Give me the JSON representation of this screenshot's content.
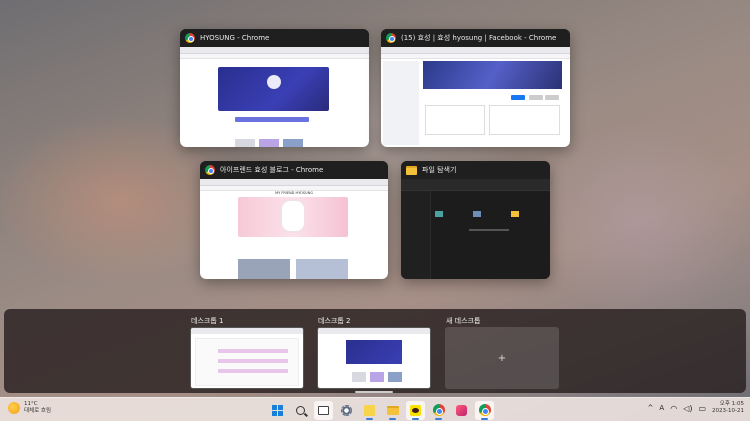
{
  "windows": [
    {
      "title": "HYOSUNG - Chrome",
      "icon": "chrome-icon"
    },
    {
      "title": "(15) 효성 | 효성 hyosung | Facebook - Chrome",
      "icon": "chrome-icon"
    },
    {
      "title": "아이프렌드 효성 블로그 - Chrome",
      "icon": "chrome-icon"
    },
    {
      "title": "파일 탐색기",
      "icon": "folder-icon"
    }
  ],
  "blog_banner_text": "MY FRIEND HYOSUNG",
  "desktops": [
    {
      "label": "데스크톱 1"
    },
    {
      "label": "데스크톱 2"
    },
    {
      "label": "새 데스크톱",
      "plus": "+"
    }
  ],
  "weather": {
    "temp": "11°C",
    "desc": "대체로 흐림"
  },
  "tray": {
    "caret": "^",
    "ime": "A",
    "clock_time": "오후 1:05",
    "clock_date": "2023-10-21"
  },
  "taskbar_icons": [
    "windows-icon",
    "search-icon",
    "task-view-icon",
    "settings-icon",
    "sticky-notes-icon",
    "file-explorer-icon",
    "kakaotalk-icon",
    "chrome-icon",
    "app-icon",
    "chrome-icon"
  ],
  "colors": {
    "accent": "#1a7fd8",
    "taskbar": "#ebe1de"
  }
}
